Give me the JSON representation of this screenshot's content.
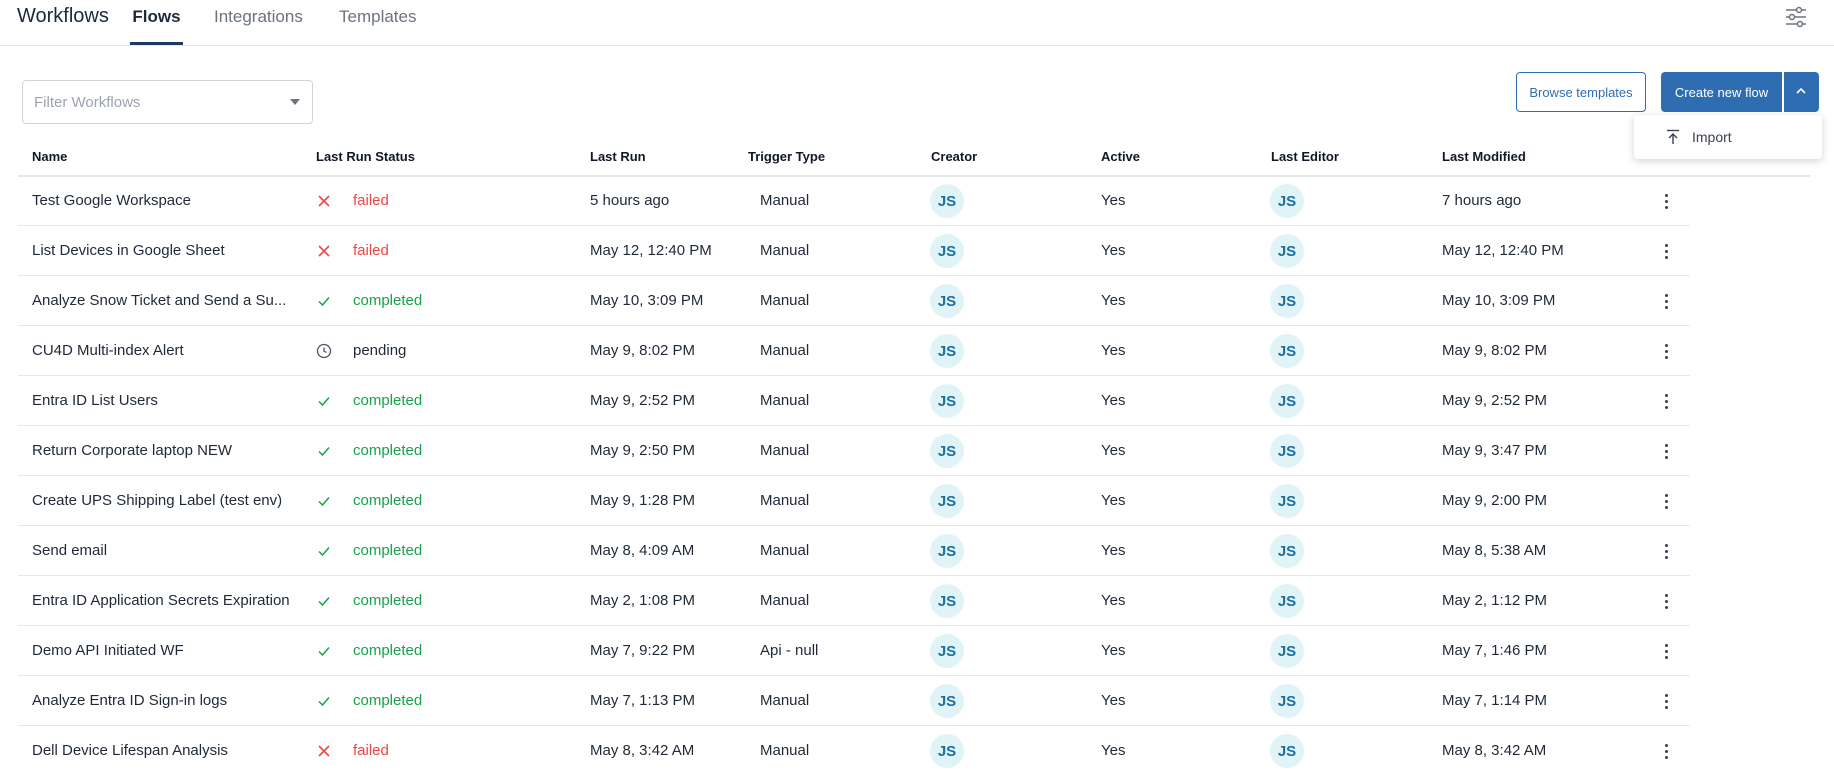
{
  "app": {
    "title": "Workflows"
  },
  "tabs": [
    {
      "label": "Flows",
      "active": true
    },
    {
      "label": "Integrations",
      "active": false
    },
    {
      "label": "Templates",
      "active": false
    }
  ],
  "toolbar": {
    "settings_icon": "sliders-icon",
    "filter_placeholder": "Filter Workflows",
    "filter_value": "",
    "browse_label": "Browse templates",
    "create_label": "Create new flow",
    "menu": {
      "import_label": "Import",
      "import_icon": "upload-icon"
    }
  },
  "colors": {
    "accent": "#2f6db3",
    "failed": "#ef4444",
    "completed": "#16a34a",
    "avatar_bg": "#e0f4f8",
    "avatar_text": "#1d6fa3"
  },
  "table": {
    "headers": {
      "name": "Name",
      "status": "Last Run Status",
      "last_run": "Last Run",
      "trigger": "Trigger Type",
      "creator": "Creator",
      "active": "Active",
      "editor": "Last Editor",
      "modified": "Last Modified"
    },
    "rows": [
      {
        "name": "Test Google Workspace",
        "status": "failed",
        "last_run": "5 hours ago",
        "trigger": "Manual",
        "creator": "JS",
        "active": "Yes",
        "editor": "JS",
        "modified": "7 hours ago"
      },
      {
        "name": "List Devices in Google Sheet",
        "status": "failed",
        "last_run": "May 12, 12:40 PM",
        "trigger": "Manual",
        "creator": "JS",
        "active": "Yes",
        "editor": "JS",
        "modified": "May 12, 12:40 PM"
      },
      {
        "name": "Analyze Snow Ticket and Send a Su...",
        "status": "completed",
        "last_run": "May 10, 3:09 PM",
        "trigger": "Manual",
        "creator": "JS",
        "active": "Yes",
        "editor": "JS",
        "modified": "May 10, 3:09 PM"
      },
      {
        "name": "CU4D Multi-index Alert",
        "status": "pending",
        "last_run": "May 9, 8:02 PM",
        "trigger": "Manual",
        "creator": "JS",
        "active": "Yes",
        "editor": "JS",
        "modified": "May 9, 8:02 PM"
      },
      {
        "name": "Entra ID List Users",
        "status": "completed",
        "last_run": "May 9, 2:52 PM",
        "trigger": "Manual",
        "creator": "JS",
        "active": "Yes",
        "editor": "JS",
        "modified": "May 9, 2:52 PM"
      },
      {
        "name": "Return Corporate laptop NEW",
        "status": "completed",
        "last_run": "May 9, 2:50 PM",
        "trigger": "Manual",
        "creator": "JS",
        "active": "Yes",
        "editor": "JS",
        "modified": "May 9, 3:47 PM"
      },
      {
        "name": "Create UPS Shipping Label (test env)",
        "status": "completed",
        "last_run": "May 9, 1:28 PM",
        "trigger": "Manual",
        "creator": "JS",
        "active": "Yes",
        "editor": "JS",
        "modified": "May 9, 2:00 PM"
      },
      {
        "name": "Send email",
        "status": "completed",
        "last_run": "May 8, 4:09 AM",
        "trigger": "Manual",
        "creator": "JS",
        "active": "Yes",
        "editor": "JS",
        "modified": "May 8, 5:38 AM"
      },
      {
        "name": "Entra ID Application Secrets Expiration",
        "status": "completed",
        "last_run": "May 2, 1:08 PM",
        "trigger": "Manual",
        "creator": "JS",
        "active": "Yes",
        "editor": "JS",
        "modified": "May 2, 1:12 PM"
      },
      {
        "name": "Demo API Initiated WF",
        "status": "completed",
        "last_run": "May 7, 9:22 PM",
        "trigger": "Api - null",
        "creator": "JS",
        "active": "Yes",
        "editor": "JS",
        "modified": "May 7, 1:46 PM"
      },
      {
        "name": "Analyze Entra ID Sign-in logs",
        "status": "completed",
        "last_run": "May 7, 1:13 PM",
        "trigger": "Manual",
        "creator": "JS",
        "active": "Yes",
        "editor": "JS",
        "modified": "May 7, 1:14 PM"
      },
      {
        "name": "Dell Device Lifespan Analysis",
        "status": "failed",
        "last_run": "May 8, 3:42 AM",
        "trigger": "Manual",
        "creator": "JS",
        "active": "Yes",
        "editor": "JS",
        "modified": "May 8, 3:42 AM"
      }
    ]
  }
}
